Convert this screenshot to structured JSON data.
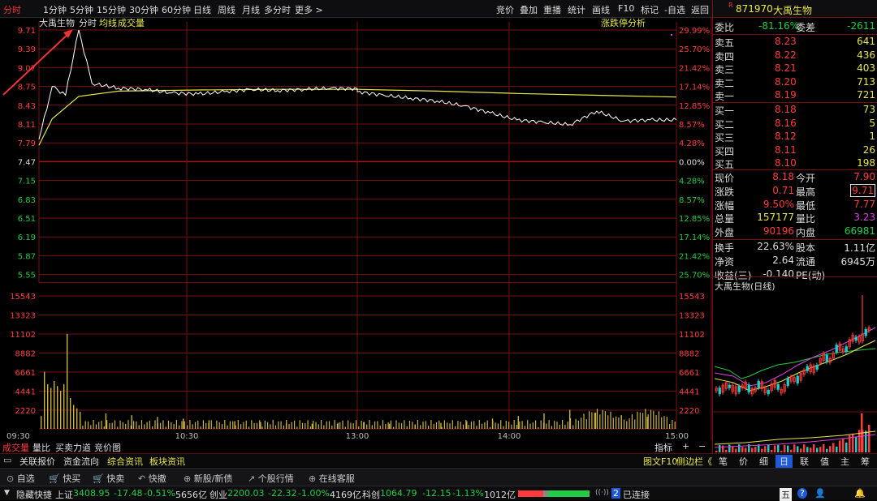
{
  "topbar": {
    "tabs_left": [
      "分时",
      "1分钟",
      "5分钟",
      "15分钟",
      "30分钟",
      "60分钟",
      "日线",
      "周线",
      "月线",
      "多分时",
      "更多 >"
    ],
    "tabs_right": [
      "竞价",
      "叠加",
      "重播",
      "统计",
      "画线",
      "F10",
      "标记",
      "-自选",
      "返回"
    ]
  },
  "chart": {
    "series_labels": {
      "name": "大禹生物",
      "fenshi": "分时",
      "avg": "均线",
      "vol": "成交量"
    },
    "analysis_label": "涨跌停分析",
    "price_ticks": [
      "9.71",
      "9.39",
      "9.07",
      "8.75",
      "8.43",
      "8.11",
      "7.79",
      "7.47",
      "7.15",
      "6.83",
      "6.51",
      "6.19",
      "5.87",
      "5.55"
    ],
    "pct_ticks": [
      "29.99%",
      "25.70%",
      "21.42%",
      "17.14%",
      "12.85%",
      "8.57%",
      "4.28%",
      "0.00%",
      "4.28%",
      "8.57%",
      "12.85%",
      "17.14%",
      "21.42%",
      "25.70%"
    ],
    "vol_ticks": [
      "15543",
      "13323",
      "11102",
      "8882",
      "6661",
      "4441",
      "2220"
    ],
    "time_ticks": [
      "09:30",
      "10:30",
      "13:00",
      "14:00",
      "15:00"
    ],
    "colors": {
      "up": "#ff3b3b",
      "down": "#22cc44",
      "price_line": "#ffffff",
      "avg_line": "#e8e84a",
      "grid": "#7a1010",
      "volume": "#c8b440",
      "annotation": "#e33"
    }
  },
  "chart_data": {
    "type": "line",
    "series": [
      {
        "name": "分时",
        "x": [
          "09:30",
          "09:35",
          "09:40",
          "09:45",
          "09:50",
          "10:00",
          "10:10",
          "10:20",
          "10:30",
          "10:40",
          "10:50",
          "11:00",
          "11:10",
          "11:20",
          "11:30",
          "13:00",
          "13:10",
          "13:20",
          "13:30",
          "13:40",
          "13:50",
          "14:00",
          "14:10",
          "14:20",
          "14:30",
          "14:40",
          "14:50",
          "15:00"
        ],
        "values": [
          7.85,
          8.75,
          8.6,
          9.71,
          8.8,
          8.72,
          8.7,
          8.64,
          8.62,
          8.66,
          8.7,
          8.68,
          8.7,
          8.72,
          8.71,
          8.66,
          8.6,
          8.55,
          8.5,
          8.42,
          8.3,
          8.18,
          8.14,
          8.1,
          8.33,
          8.16,
          8.18,
          8.18
        ]
      },
      {
        "name": "均线",
        "x": [
          "09:30",
          "09:35",
          "09:45",
          "10:00",
          "10:30",
          "11:00",
          "11:30",
          "13:00",
          "13:30",
          "14:00",
          "14:30",
          "15:00"
        ],
        "values": [
          7.75,
          8.2,
          8.58,
          8.67,
          8.69,
          8.7,
          8.7,
          8.7,
          8.67,
          8.63,
          8.6,
          8.57
        ]
      }
    ],
    "volume": [
      1500,
      6661,
      5200,
      4800,
      5600,
      5000,
      4441,
      5200,
      11102,
      3600,
      2800,
      2400,
      2000,
      1800,
      1600,
      1400,
      1200,
      1000,
      900,
      800,
      700,
      600,
      700,
      800,
      600,
      500,
      700,
      900,
      1200,
      1500,
      1800,
      2220,
      1900,
      1600,
      1400
    ],
    "ylim": [
      5.55,
      9.71
    ],
    "prev_close": 7.47
  },
  "tabs": {
    "vol_tabs": [
      "成交量",
      "量比",
      "买卖力道",
      "竞价图"
    ],
    "right_controls": [
      "指标",
      "+",
      "−"
    ],
    "info_tabs": [
      "关联报价",
      "资金流向",
      "综合资讯",
      "板块资讯"
    ],
    "info_right": "图文F10",
    "info_right2": "侧边栏《"
  },
  "quote": {
    "code": "871970",
    "name": "大禹生物",
    "weibi_label": "委比",
    "weibi": "-81.16%",
    "weicha_label": "委差",
    "weicha": "-2611",
    "asks": [
      {
        "label": "卖五",
        "price": "8.23",
        "vol": "641"
      },
      {
        "label": "卖四",
        "price": "8.22",
        "vol": "436"
      },
      {
        "label": "卖三",
        "price": "8.21",
        "vol": "403"
      },
      {
        "label": "卖二",
        "price": "8.20",
        "vol": "713"
      },
      {
        "label": "卖一",
        "price": "8.19",
        "vol": "721"
      }
    ],
    "bids": [
      {
        "label": "买一",
        "price": "8.18",
        "vol": "73"
      },
      {
        "label": "买二",
        "price": "8.16",
        "vol": "5"
      },
      {
        "label": "买三",
        "price": "8.12",
        "vol": "1"
      },
      {
        "label": "买四",
        "price": "8.11",
        "vol": "26"
      },
      {
        "label": "买五",
        "price": "8.10",
        "vol": "198"
      }
    ],
    "stats": [
      {
        "l1": "现价",
        "v1": "8.18",
        "c1": "red",
        "l2": "今开",
        "v2": "7.90",
        "c2": "red"
      },
      {
        "l1": "涨跌",
        "v1": "0.71",
        "c1": "red",
        "l2": "最高",
        "v2": "9.71",
        "c2": "red"
      },
      {
        "l1": "涨幅",
        "v1": "9.50%",
        "c1": "red",
        "l2": "最低",
        "v2": "7.77",
        "c2": "red"
      },
      {
        "l1": "总量",
        "v1": "157177",
        "c1": "yellow",
        "l2": "量比",
        "v2": "3.23",
        "c2": "magenta"
      },
      {
        "l1": "外盘",
        "v1": "90196",
        "c1": "red",
        "l2": "内盘",
        "v2": "66981",
        "c2": "green"
      },
      {
        "l1": "换手",
        "v1": "22.63%",
        "c1": "white",
        "l2": "股本",
        "v2": "1.11亿",
        "c2": "white"
      },
      {
        "l1": "净资",
        "v1": "2.64",
        "c1": "white",
        "l2": "流通",
        "v2": "6945万",
        "c2": "white"
      },
      {
        "l1": "收益(三)",
        "v1": "-0.140",
        "c1": "white",
        "l2": "PE(动)",
        "v2": "",
        "c2": "white"
      }
    ],
    "daily_title": "大禹生物(日线)"
  },
  "side_tabs": [
    "笔",
    "价",
    "细",
    "日",
    "联",
    "值",
    "主",
    "筹"
  ],
  "toolbar": [
    "自选",
    "快买",
    "快卖",
    "快撤",
    "新股/新债",
    "个股行情",
    "在线客服"
  ],
  "status": {
    "hide": "隐藏快捷",
    "sh_label": "上证",
    "sh": "3408.95",
    "sh_chg": "-17.48",
    "sh_pct": "-0.51%",
    "sh_amt": "5656亿",
    "cy_label": "创业",
    "cy": "2200.03",
    "cy_chg": "-22.32",
    "cy_pct": "-1.00%",
    "cy_amt": "4169亿",
    "kc_label": "科创",
    "kc": "1064.79",
    "kc_chg": "-12.15",
    "kc_pct": "-1.13%",
    "kc_amt": "1012亿",
    "conn": "已连接",
    "conn_count": "2",
    "right_icons": [
      "五"
    ]
  }
}
